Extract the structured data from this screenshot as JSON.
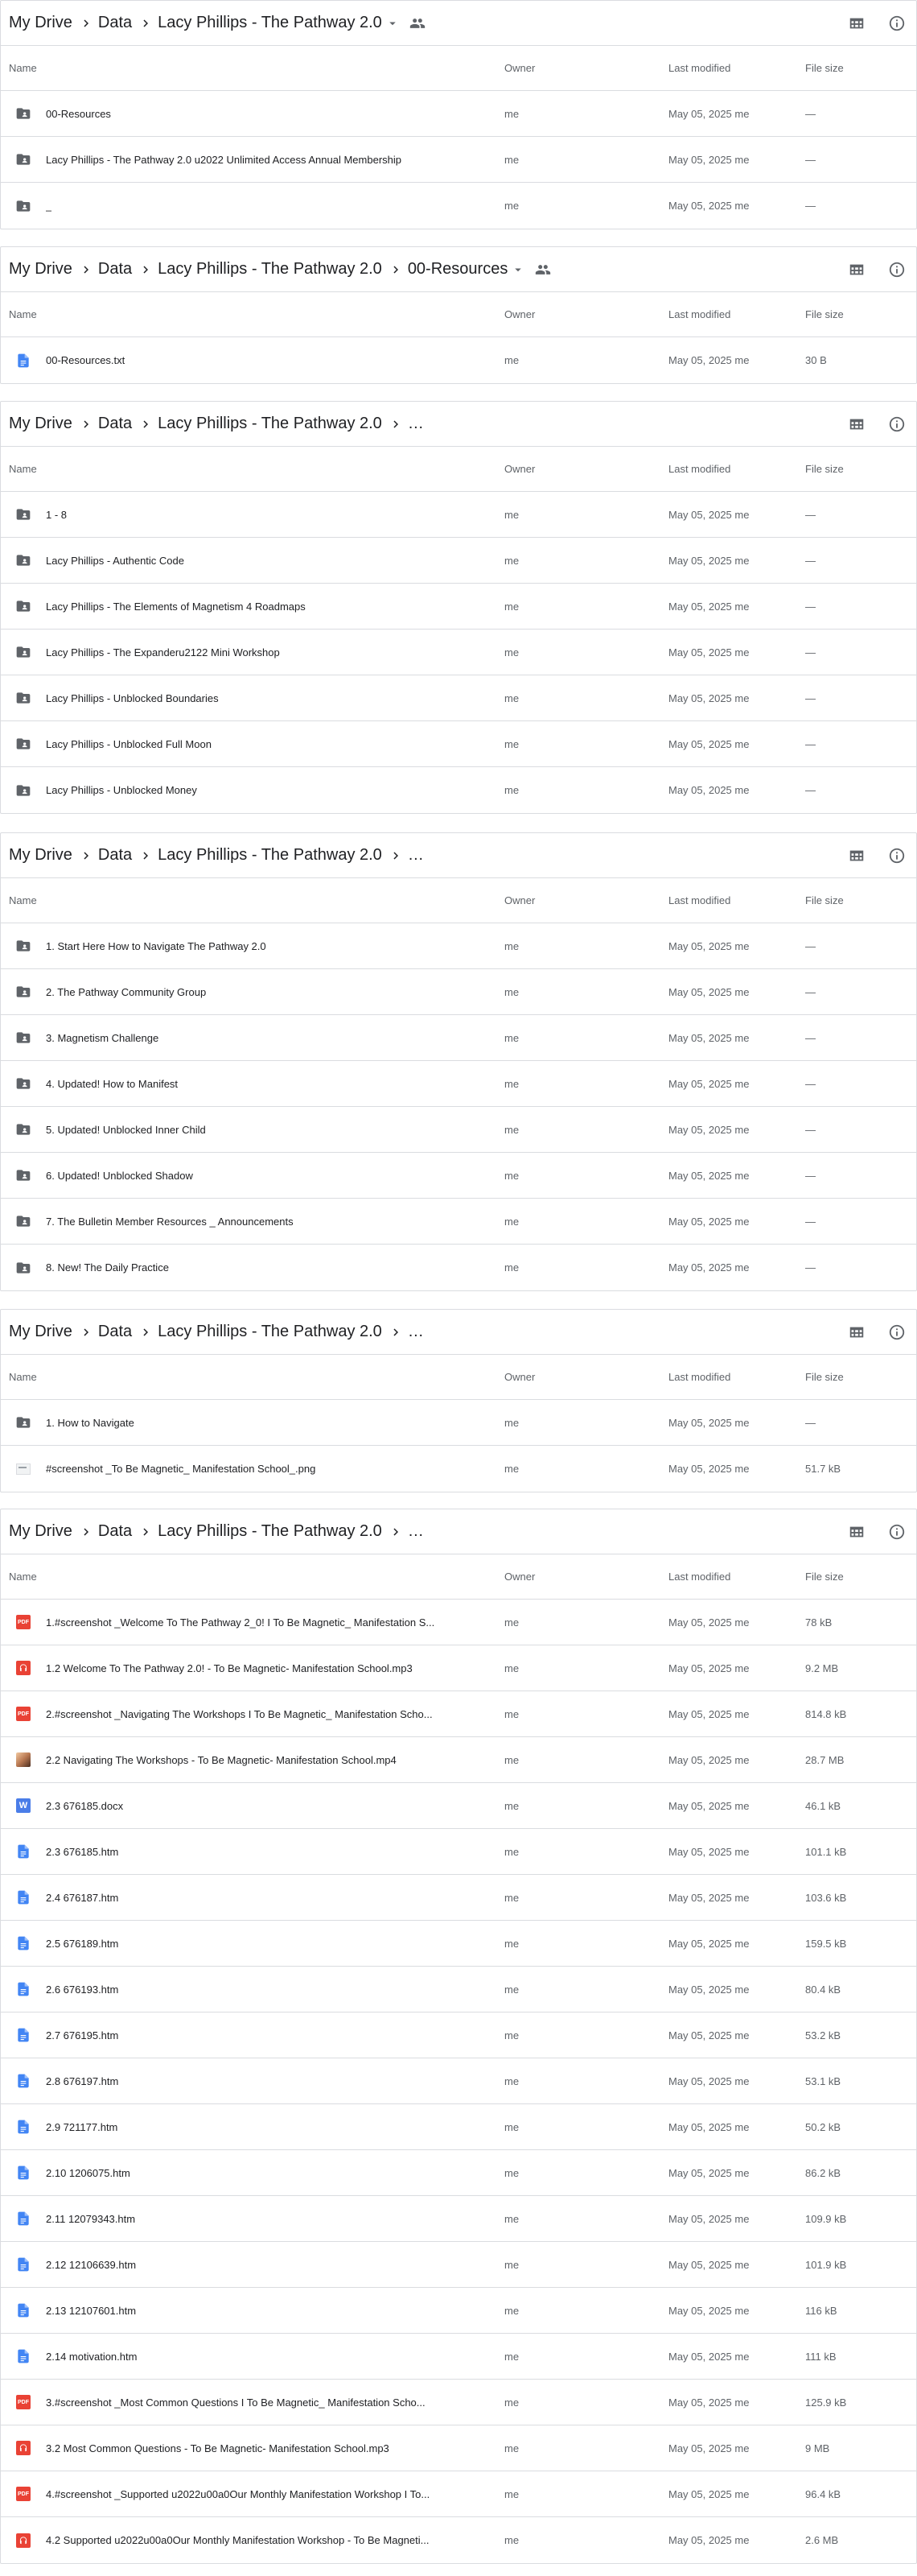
{
  "columns": {
    "name": "Name",
    "owner": "Owner",
    "modified": "Last modified",
    "size": "File size"
  },
  "panels": [
    {
      "crumbs": [
        "My Drive",
        "Data",
        "Lacy Phillips - The Pathway 2.0"
      ],
      "truncated": false,
      "dropdown": true,
      "shared": true,
      "rows": [
        {
          "icon": "folder",
          "name": "00-Resources",
          "owner": "me",
          "modified": "May 05, 2025 me",
          "size": "—"
        },
        {
          "icon": "folder",
          "name": "Lacy Phillips - The Pathway 2.0 u2022 Unlimited Access Annual Membership",
          "owner": "me",
          "modified": "May 05, 2025 me",
          "size": "—"
        },
        {
          "icon": "folder",
          "name": "_",
          "owner": "me",
          "modified": "May 05, 2025 me",
          "size": "—"
        }
      ]
    },
    {
      "crumbs": [
        "My Drive",
        "Data",
        "Lacy Phillips - The Pathway 2.0",
        "00-Resources"
      ],
      "truncated": false,
      "dropdown": true,
      "shared": true,
      "rows": [
        {
          "icon": "doc",
          "name": "00-Resources.txt",
          "owner": "me",
          "modified": "May 05, 2025 me",
          "size": "30 B"
        }
      ]
    },
    {
      "crumbs": [
        "My Drive",
        "Data",
        "Lacy Phillips - The Pathway 2.0"
      ],
      "truncated": true,
      "dropdown": false,
      "shared": false,
      "rows": [
        {
          "icon": "folder",
          "name": "1 - 8",
          "owner": "me",
          "modified": "May 05, 2025 me",
          "size": "—"
        },
        {
          "icon": "folder",
          "name": "Lacy Phillips - Authentic Code",
          "owner": "me",
          "modified": "May 05, 2025 me",
          "size": "—"
        },
        {
          "icon": "folder",
          "name": "Lacy Phillips - The Elements of Magnetism 4 Roadmaps",
          "owner": "me",
          "modified": "May 05, 2025 me",
          "size": "—"
        },
        {
          "icon": "folder",
          "name": "Lacy Phillips - The Expanderu2122 Mini Workshop",
          "owner": "me",
          "modified": "May 05, 2025 me",
          "size": "—"
        },
        {
          "icon": "folder",
          "name": "Lacy Phillips - Unblocked Boundaries",
          "owner": "me",
          "modified": "May 05, 2025 me",
          "size": "—"
        },
        {
          "icon": "folder",
          "name": "Lacy Phillips - Unblocked Full Moon",
          "owner": "me",
          "modified": "May 05, 2025 me",
          "size": "—"
        },
        {
          "icon": "folder",
          "name": "Lacy Phillips - Unblocked Money",
          "owner": "me",
          "modified": "May 05, 2025 me",
          "size": "—"
        }
      ]
    },
    {
      "crumbs": [
        "My Drive",
        "Data",
        "Lacy Phillips - The Pathway 2.0"
      ],
      "truncated": true,
      "dropdown": false,
      "shared": false,
      "rows": [
        {
          "icon": "folder",
          "name": "1. Start Here How to Navigate The Pathway 2.0",
          "owner": "me",
          "modified": "May 05, 2025 me",
          "size": "—"
        },
        {
          "icon": "folder",
          "name": "2. The Pathway Community Group",
          "owner": "me",
          "modified": "May 05, 2025 me",
          "size": "—"
        },
        {
          "icon": "folder",
          "name": "3. Magnetism Challenge",
          "owner": "me",
          "modified": "May 05, 2025 me",
          "size": "—"
        },
        {
          "icon": "folder",
          "name": "4. Updated! How to Manifest",
          "owner": "me",
          "modified": "May 05, 2025 me",
          "size": "—"
        },
        {
          "icon": "folder",
          "name": "5. Updated! Unblocked Inner Child",
          "owner": "me",
          "modified": "May 05, 2025 me",
          "size": "—"
        },
        {
          "icon": "folder",
          "name": "6. Updated! Unblocked Shadow",
          "owner": "me",
          "modified": "May 05, 2025 me",
          "size": "—"
        },
        {
          "icon": "folder",
          "name": "7. The Bulletin Member Resources _ Announcements",
          "owner": "me",
          "modified": "May 05, 2025 me",
          "size": "—"
        },
        {
          "icon": "folder",
          "name": "8. New! The Daily Practice",
          "owner": "me",
          "modified": "May 05, 2025 me",
          "size": "—"
        }
      ]
    },
    {
      "crumbs": [
        "My Drive",
        "Data",
        "Lacy Phillips - The Pathway 2.0"
      ],
      "truncated": true,
      "dropdown": false,
      "shared": false,
      "rows": [
        {
          "icon": "folder",
          "name": "1. How to Navigate",
          "owner": "me",
          "modified": "May 05, 2025 me",
          "size": "—"
        },
        {
          "icon": "image",
          "name": "#screenshot _To Be Magnetic_ Manifestation School_.png",
          "owner": "me",
          "modified": "May 05, 2025 me",
          "size": "51.7 kB"
        }
      ]
    },
    {
      "crumbs": [
        "My Drive",
        "Data",
        "Lacy Phillips - The Pathway 2.0"
      ],
      "truncated": true,
      "dropdown": false,
      "shared": false,
      "rows": [
        {
          "icon": "pdf",
          "name": "1.#screenshot _Welcome To The Pathway 2_0! I To Be Magnetic_ Manifestation S...",
          "owner": "me",
          "modified": "May 05, 2025 me",
          "size": "78 kB"
        },
        {
          "icon": "audio",
          "name": "1.2 Welcome To The Pathway 2.0! - To Be Magnetic- Manifestation School.mp3",
          "owner": "me",
          "modified": "May 05, 2025 me",
          "size": "9.2 MB"
        },
        {
          "icon": "pdf",
          "name": "2.#screenshot _Navigating The Workshops I To Be Magnetic_ Manifestation Scho...",
          "owner": "me",
          "modified": "May 05, 2025 me",
          "size": "814.8 kB"
        },
        {
          "icon": "video",
          "name": "2.2 Navigating The Workshops - To Be Magnetic- Manifestation School.mp4",
          "owner": "me",
          "modified": "May 05, 2025 me",
          "size": "28.7 MB"
        },
        {
          "icon": "word",
          "name": "2.3 676185.docx",
          "owner": "me",
          "modified": "May 05, 2025 me",
          "size": "46.1 kB"
        },
        {
          "icon": "doc",
          "name": "2.3 676185.htm",
          "owner": "me",
          "modified": "May 05, 2025 me",
          "size": "101.1 kB"
        },
        {
          "icon": "doc",
          "name": "2.4 676187.htm",
          "owner": "me",
          "modified": "May 05, 2025 me",
          "size": "103.6 kB"
        },
        {
          "icon": "doc",
          "name": "2.5 676189.htm",
          "owner": "me",
          "modified": "May 05, 2025 me",
          "size": "159.5 kB"
        },
        {
          "icon": "doc",
          "name": "2.6 676193.htm",
          "owner": "me",
          "modified": "May 05, 2025 me",
          "size": "80.4 kB"
        },
        {
          "icon": "doc",
          "name": "2.7 676195.htm",
          "owner": "me",
          "modified": "May 05, 2025 me",
          "size": "53.2 kB"
        },
        {
          "icon": "doc",
          "name": "2.8 676197.htm",
          "owner": "me",
          "modified": "May 05, 2025 me",
          "size": "53.1 kB"
        },
        {
          "icon": "doc",
          "name": "2.9 721177.htm",
          "owner": "me",
          "modified": "May 05, 2025 me",
          "size": "50.2 kB"
        },
        {
          "icon": "doc",
          "name": "2.10 1206075.htm",
          "owner": "me",
          "modified": "May 05, 2025 me",
          "size": "86.2 kB"
        },
        {
          "icon": "doc",
          "name": "2.11 12079343.htm",
          "owner": "me",
          "modified": "May 05, 2025 me",
          "size": "109.9 kB"
        },
        {
          "icon": "doc",
          "name": "2.12 12106639.htm",
          "owner": "me",
          "modified": "May 05, 2025 me",
          "size": "101.9 kB"
        },
        {
          "icon": "doc",
          "name": "2.13 12107601.htm",
          "owner": "me",
          "modified": "May 05, 2025 me",
          "size": "116 kB"
        },
        {
          "icon": "doc",
          "name": "2.14 motivation.htm",
          "owner": "me",
          "modified": "May 05, 2025 me",
          "size": "111 kB"
        },
        {
          "icon": "pdf",
          "name": "3.#screenshot _Most Common Questions I To Be Magnetic_ Manifestation Scho...",
          "owner": "me",
          "modified": "May 05, 2025 me",
          "size": "125.9 kB"
        },
        {
          "icon": "audio",
          "name": "3.2 Most Common Questions - To Be Magnetic- Manifestation School.mp3",
          "owner": "me",
          "modified": "May 05, 2025 me",
          "size": "9 MB"
        },
        {
          "icon": "pdf",
          "name": "4.#screenshot _Supported u2022u00a0Our Monthly Manifestation Workshop I To...",
          "owner": "me",
          "modified": "May 05, 2025 me",
          "size": "96.4 kB"
        },
        {
          "icon": "audio",
          "name": "4.2 Supported u2022u00a0Our Monthly Manifestation Workshop - To Be Magneti...",
          "owner": "me",
          "modified": "May 05, 2025 me",
          "size": "2.6 MB"
        }
      ]
    }
  ]
}
